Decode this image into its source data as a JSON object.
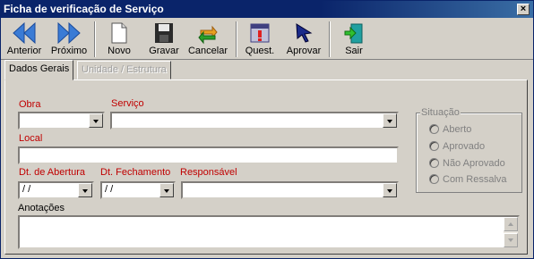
{
  "window": {
    "title": "Ficha de verificação de Serviço",
    "close_label": "×"
  },
  "toolbar": {
    "anterior": "Anterior",
    "proximo": "Próximo",
    "novo": "Novo",
    "gravar": "Gravar",
    "cancelar": "Cancelar",
    "quest": "Quest.",
    "aprovar": "Aprovar",
    "sair": "Sair"
  },
  "tabs": {
    "dados_gerais": "Dados Gerais",
    "unidade": "Unidade / Estrutura"
  },
  "form": {
    "obra_label": "Obra",
    "obra_value": "",
    "servico_label": "Serviço",
    "servico_value": "",
    "local_label": "Local",
    "local_value": "",
    "dt_abertura_label": "Dt. de Abertura",
    "dt_abertura_value": " /  /",
    "dt_fechamento_label": "Dt. Fechamento",
    "dt_fechamento_value": " /  /",
    "responsavel_label": "Responsável",
    "responsavel_value": "",
    "anotacoes_label": "Anotações",
    "anotacoes_value": ""
  },
  "situacao": {
    "title": "Situação",
    "options": [
      "Aberto",
      "Aprovado",
      "Não Aprovado",
      "Com Ressalva"
    ]
  },
  "colors": {
    "title_bar": "#0a246a",
    "required_label": "#c00000",
    "face": "#d4d0c8"
  }
}
